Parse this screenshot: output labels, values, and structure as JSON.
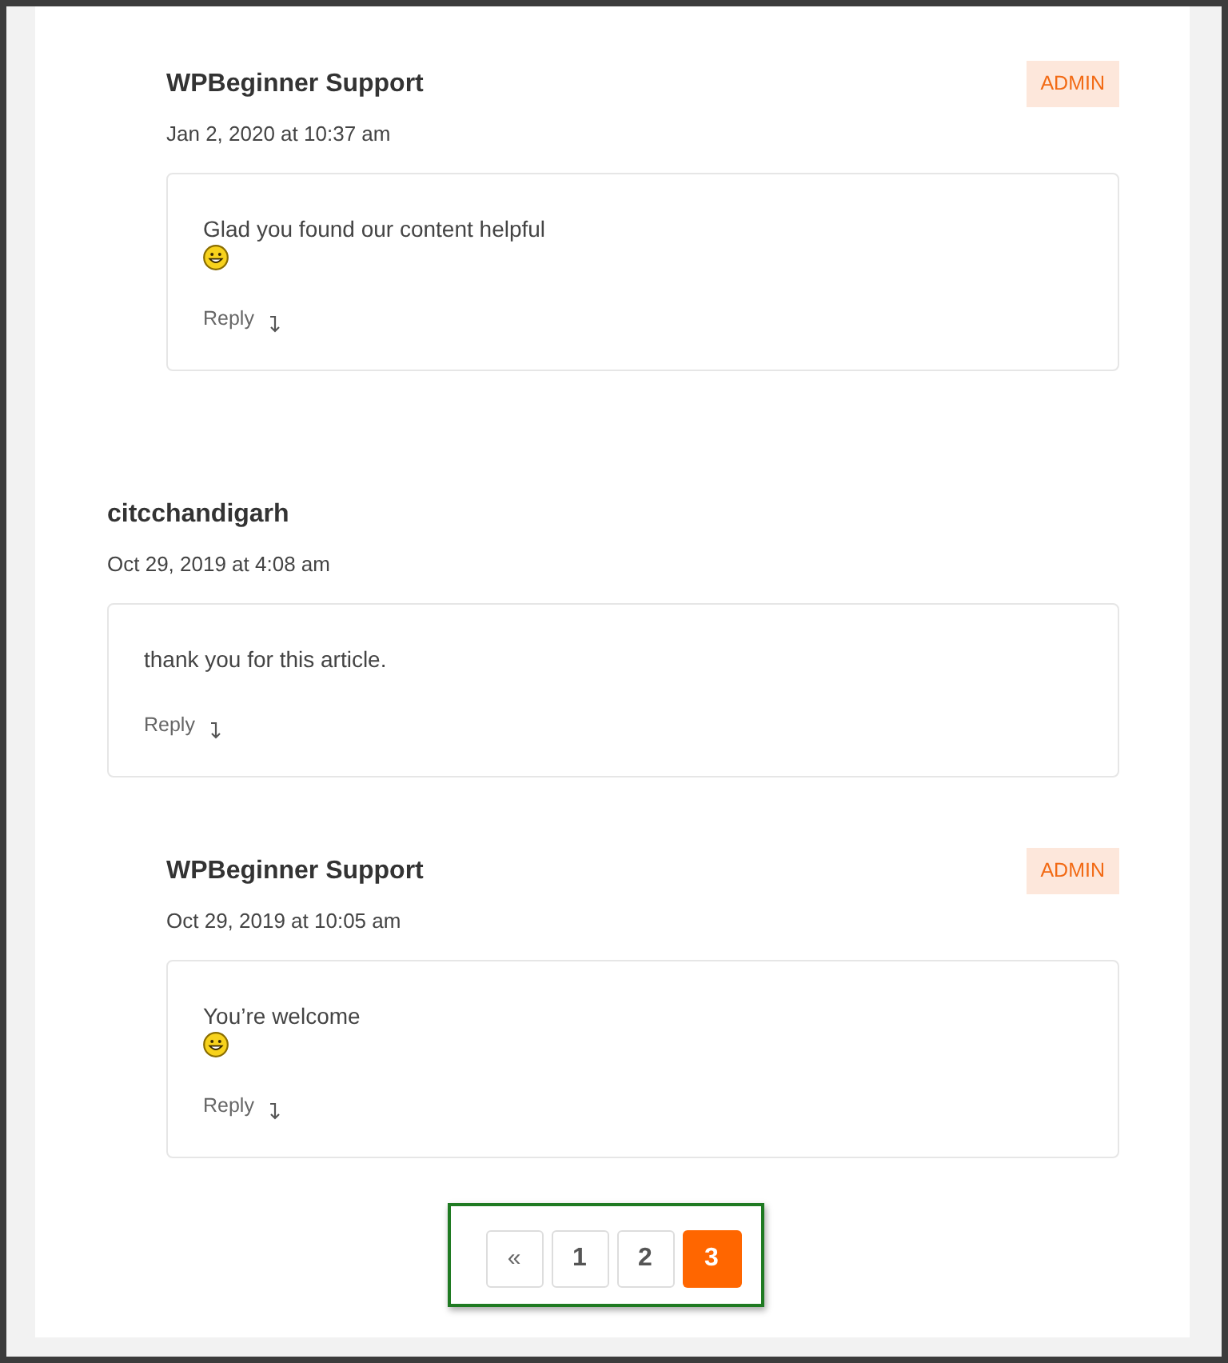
{
  "comments": [
    {
      "kind": "reply",
      "author": "WPBeginner Support",
      "badge": "ADMIN",
      "date": "Jan 2, 2020 at 10:37 am",
      "text": "Glad you found our content helpful",
      "emoji": true,
      "reply_label": "Reply"
    },
    {
      "kind": "comment",
      "author": "citcchandigarh",
      "date": "Oct 29, 2019 at 4:08 am",
      "text": "thank you for this article.",
      "emoji": false,
      "reply_label": "Reply"
    },
    {
      "kind": "reply",
      "author": "WPBeginner Support",
      "badge": "ADMIN",
      "date": "Oct 29, 2019 at 10:05 am",
      "text": "You’re welcome",
      "emoji": true,
      "reply_label": "Reply"
    }
  ],
  "pagination": {
    "highlighted": true,
    "prev": "«",
    "pages": [
      {
        "label": "1",
        "selected": false
      },
      {
        "label": "2",
        "selected": false
      },
      {
        "label": "3",
        "selected": true
      }
    ]
  }
}
